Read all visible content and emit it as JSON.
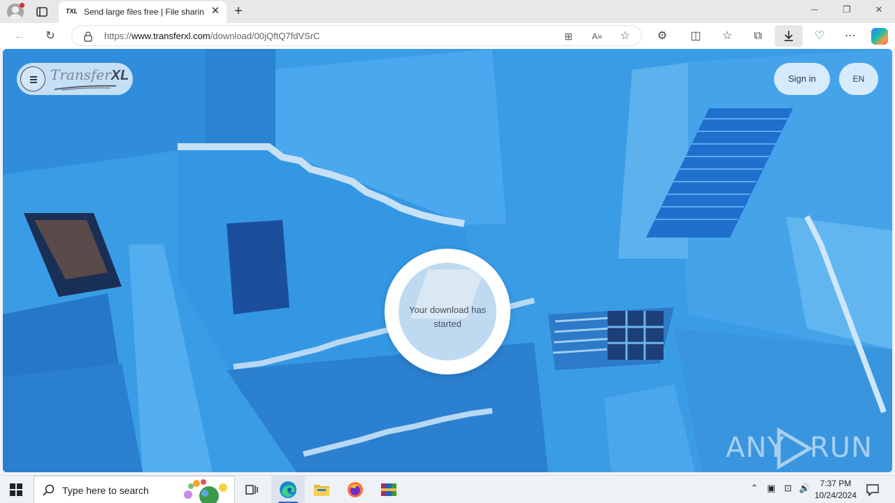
{
  "browser": {
    "tab": {
      "favicon_text": "TXL",
      "title": "Send large files free | File sharing"
    },
    "address": {
      "prefix": "https://",
      "host": "www.transferxl.com",
      "path": "/download/00jQftQ7fdVSrC"
    }
  },
  "page": {
    "logo": {
      "transfer": "Transfer",
      "xl": "XL"
    },
    "sign_in": "Sign in",
    "language": "EN",
    "status": "Your download has started",
    "watermark": {
      "left": "ANY",
      "right": "RUN"
    }
  },
  "taskbar": {
    "search_placeholder": "Type here to search",
    "time": "7:37 PM",
    "date": "10/24/2024"
  },
  "colors": {
    "wall_blue": "#3a9be6",
    "accent": "#2b67c7"
  }
}
